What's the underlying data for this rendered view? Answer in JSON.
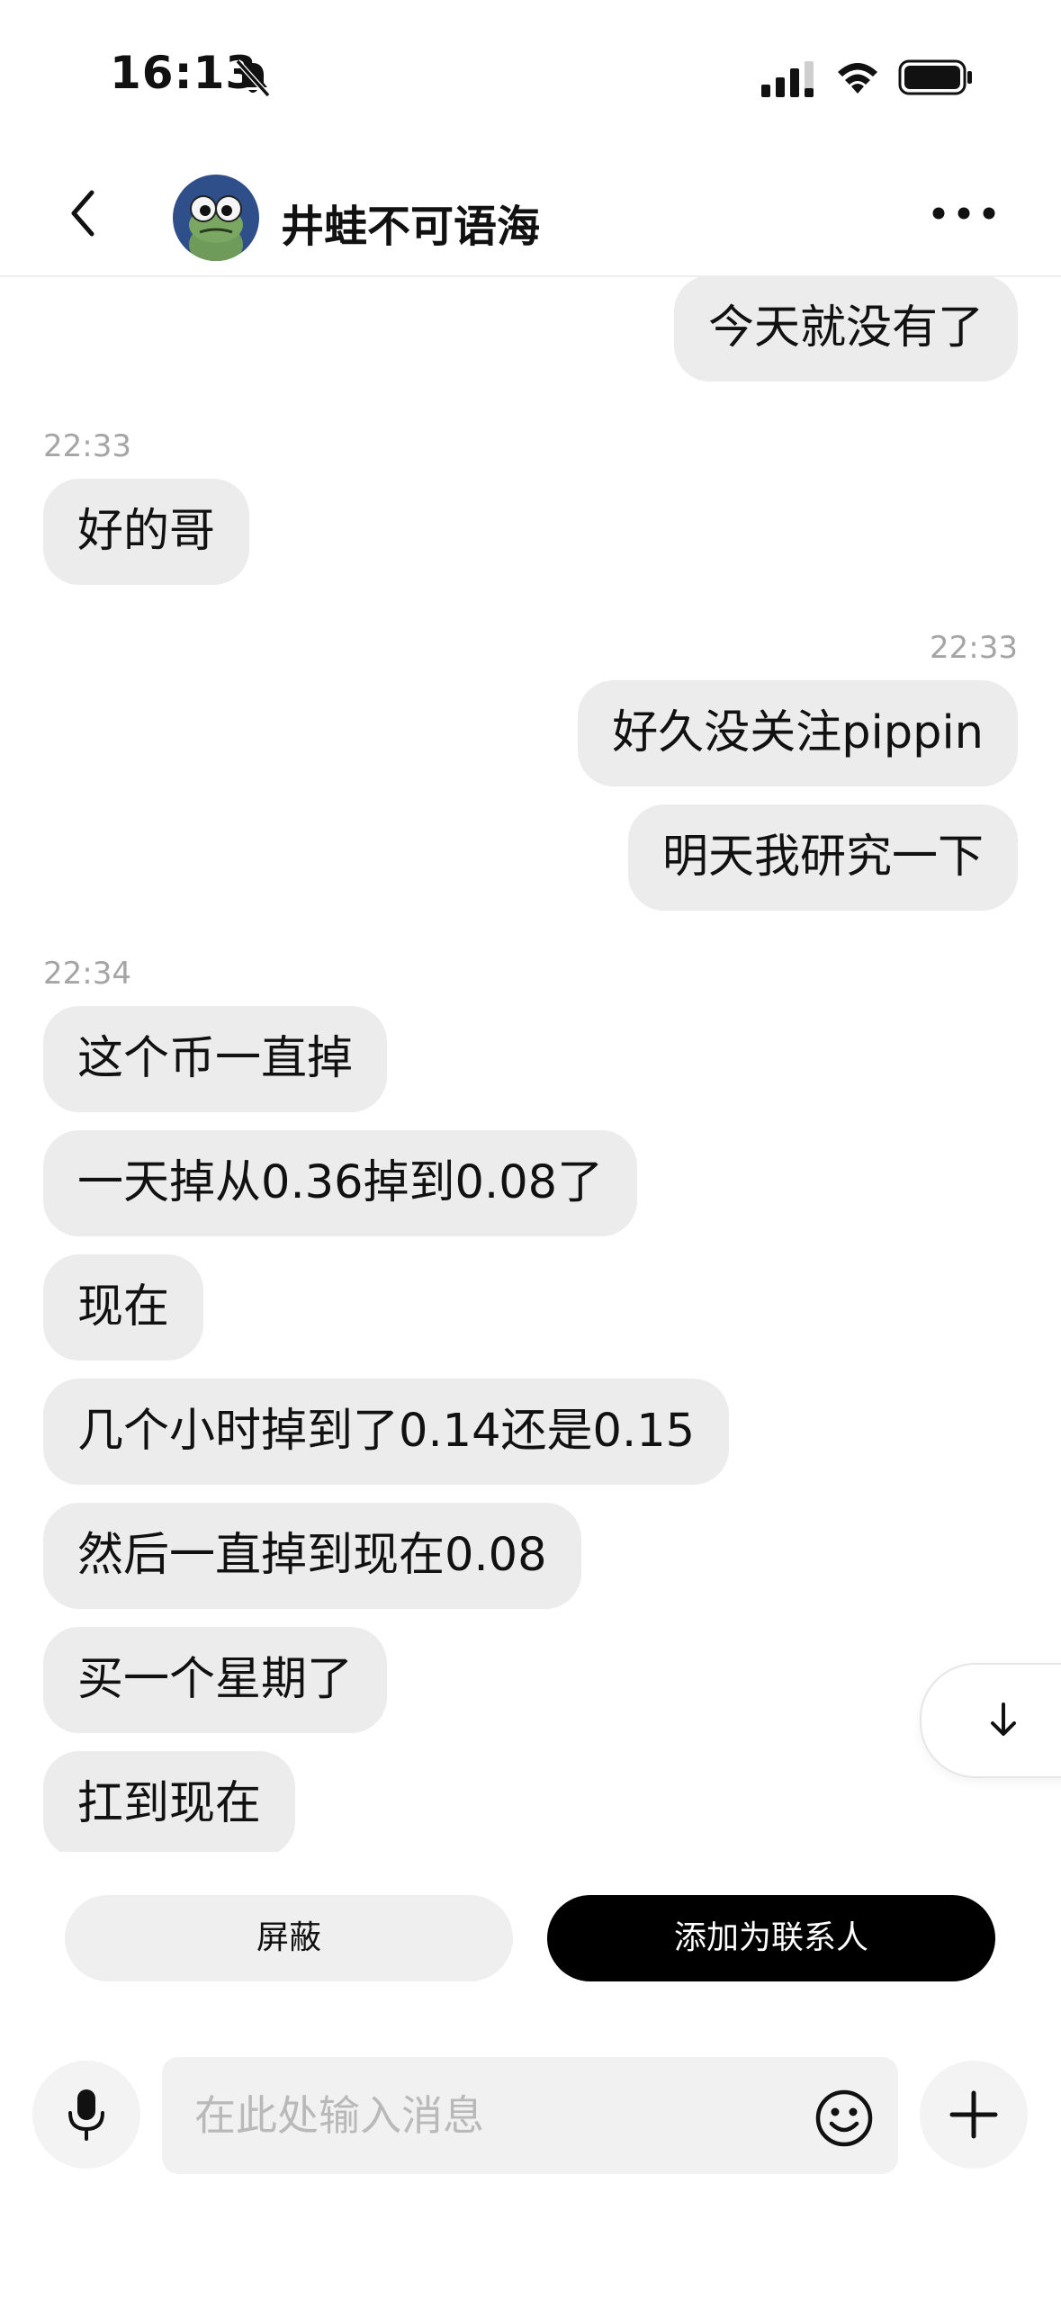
{
  "status_bar": {
    "time": "16:13"
  },
  "header": {
    "contact_name": "井蛙不可语海",
    "back_icon": "chevron-left-icon",
    "more_icon": "more-horizontal-icon"
  },
  "messages": [
    {
      "side": "right",
      "text": "今天就没有了"
    },
    {
      "timestamp": "22:33",
      "side": "left"
    },
    {
      "side": "left",
      "text": "好的哥"
    },
    {
      "timestamp": "22:33",
      "side": "right"
    },
    {
      "side": "right",
      "text": "好久没关注pippin"
    },
    {
      "side": "right",
      "text": "明天我研究一下"
    },
    {
      "timestamp": "22:34",
      "side": "left"
    },
    {
      "side": "left",
      "text": "这个币一直掉"
    },
    {
      "side": "left",
      "text": "一天掉从0.36掉到0.08了"
    },
    {
      "side": "left",
      "text": "现在"
    },
    {
      "side": "left",
      "text": "几个小时掉到了0.14还是0.15"
    },
    {
      "side": "left",
      "text": "然后一直掉到现在0.08"
    },
    {
      "side": "left",
      "text": "买一个星期了"
    },
    {
      "side": "left",
      "text": "扛到现在"
    }
  ],
  "actions": {
    "block_label": "屏蔽",
    "add_contact_label": "添加为联系人"
  },
  "input": {
    "placeholder": "在此处输入消息",
    "value": ""
  },
  "colors": {
    "bubble_bg": "#ececec",
    "primary_button_bg": "#000000",
    "timestamp": "#a5a5a5"
  }
}
